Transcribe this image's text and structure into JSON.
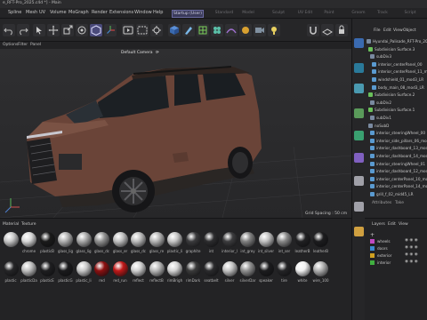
{
  "window": {
    "title": "e_RFT-Pro_2025.c4d *] - Main"
  },
  "menu": {
    "items": [
      "Spline",
      "Mesh",
      "UV",
      "Volume",
      "MoGraph",
      "Render",
      "Extensions",
      "Window",
      "Help"
    ],
    "layouts": [
      "Startup (User)",
      "Standard",
      "Model",
      "Sculpt",
      "UV Edit",
      "Paint",
      "Groom",
      "Track",
      "Script"
    ]
  },
  "viewport": {
    "menu": [
      "Options",
      "Filter",
      "Panel"
    ],
    "camera_label": "Default Camera",
    "grid_spacing": "Grid Spacing : 50 cm"
  },
  "materials": {
    "tabs": [
      "Material",
      "Texture"
    ],
    "rows": [
      [
        {
          "name": "",
          "color": "#c8c8c8"
        },
        {
          "name": "chrome",
          "color": "#d8d8d8"
        },
        {
          "name": "plasticB",
          "color": "#1a1a1a"
        },
        {
          "name": "glass_lig",
          "color": "#b0b0b0"
        },
        {
          "name": "glass_lig",
          "color": "#a8a8a8"
        },
        {
          "name": "glass_dc",
          "color": "#909090"
        },
        {
          "name": "glass_er",
          "color": "#c0c0c0"
        },
        {
          "name": "glass_dc",
          "color": "#bcbcbc"
        },
        {
          "name": "glass_re",
          "color": "#b4b4b4"
        },
        {
          "name": "plastic_li",
          "color": "#c4c4c4"
        },
        {
          "name": "graphite",
          "color": "#3a3a3c"
        },
        {
          "name": "int",
          "color": "#2c2c2e"
        },
        {
          "name": "interior_l",
          "color": "#3c3c3e"
        },
        {
          "name": "int_grey",
          "color": "#808080"
        },
        {
          "name": "int_silver",
          "color": "#c0c0c0"
        },
        {
          "name": "int_ser",
          "color": "#888888"
        },
        {
          "name": "leatherB",
          "color": "#202022"
        },
        {
          "name": "leatherB",
          "color": "#1c1c1e"
        }
      ],
      [
        {
          "name": "plastic",
          "color": "#252527"
        },
        {
          "name": "plasticDa",
          "color": "#c0c0c0"
        },
        {
          "name": "plasticE",
          "color": "#1e1e20"
        },
        {
          "name": "plasticG",
          "color": "#1a1a1c"
        },
        {
          "name": "plastic_li",
          "color": "#c8c8c8"
        },
        {
          "name": "red",
          "color": "#8c1010"
        },
        {
          "name": "red_run",
          "color": "#c01818"
        },
        {
          "name": "reflect",
          "color": "#d0d0d0"
        },
        {
          "name": "reflectB",
          "color": "#b8b8b8"
        },
        {
          "name": "rimBrigh",
          "color": "#d4d4d4"
        },
        {
          "name": "rimDark",
          "color": "#3a3a3a"
        },
        {
          "name": "seatbelt",
          "color": "#2a2a2c"
        },
        {
          "name": "silver",
          "color": "#c4c4c4"
        },
        {
          "name": "silverDar",
          "color": "#909090"
        },
        {
          "name": "speaker",
          "color": "#1c1c1e"
        },
        {
          "name": "tire",
          "color": "#242426"
        },
        {
          "name": "white",
          "color": "#f0f0f0"
        },
        {
          "name": "wire_100",
          "color": "#b0b0b0"
        }
      ]
    ]
  },
  "objects": {
    "menu": [
      "File",
      "Edit",
      "View",
      "Object"
    ],
    "items": [
      {
        "name": "Hyundai_Palisade_RFT-Pro_2025",
        "icon": "null-icon"
      },
      {
        "name": "Subdivision Surface.3",
        "icon": "subdiv-icon"
      },
      {
        "name": "subDiv3",
        "icon": "null-icon"
      },
      {
        "name": "interior_centerPanel_00",
        "icon": "mesh-icon"
      },
      {
        "name": "interior_centerPanel_11_mod",
        "icon": "mesh-icon"
      },
      {
        "name": "windshield_01_mod3_LR",
        "icon": "mesh-icon"
      },
      {
        "name": "body_main_08_mod3_LR",
        "icon": "mesh-icon"
      },
      {
        "name": "Subdivision Surface.2",
        "icon": "subdiv-icon"
      },
      {
        "name": "subDiv2",
        "icon": "null-icon"
      },
      {
        "name": "Subdivision Surface.1",
        "icon": "subdiv-icon"
      },
      {
        "name": "subDiv1",
        "icon": "null-icon"
      },
      {
        "name": "noSubD",
        "icon": "null-icon"
      },
      {
        "name": "interior_steeringWheel_00",
        "icon": "mesh-icon"
      },
      {
        "name": "interior_side_pillars_06_mod",
        "icon": "mesh-icon"
      },
      {
        "name": "interior_dashboard_13_mod",
        "icon": "mesh-icon"
      },
      {
        "name": "interior_dashboard_14_mod",
        "icon": "mesh-icon"
      },
      {
        "name": "interior_steeringWheel_01",
        "icon": "mesh-icon"
      },
      {
        "name": "interior_dashboard_12_mod",
        "icon": "mesh-icon"
      },
      {
        "name": "interior_centerPanel_10_mod",
        "icon": "mesh-icon"
      },
      {
        "name": "interior_centerPanel_14_mod",
        "icon": "mesh-icon"
      },
      {
        "name": "grill_f_02_mid45_LR",
        "icon": "mesh-icon"
      }
    ]
  },
  "attributes": {
    "tabs": [
      "Attributes",
      "Take"
    ]
  },
  "layers": {
    "menu": [
      "Layers",
      "Edit",
      "View"
    ],
    "items": [
      {
        "name": "wheels",
        "color": "#c04ac0"
      },
      {
        "name": "doors",
        "color": "#3a8ad0"
      },
      {
        "name": "exterior",
        "color": "#d0a020"
      },
      {
        "name": "interior",
        "color": "#40b040"
      }
    ]
  }
}
